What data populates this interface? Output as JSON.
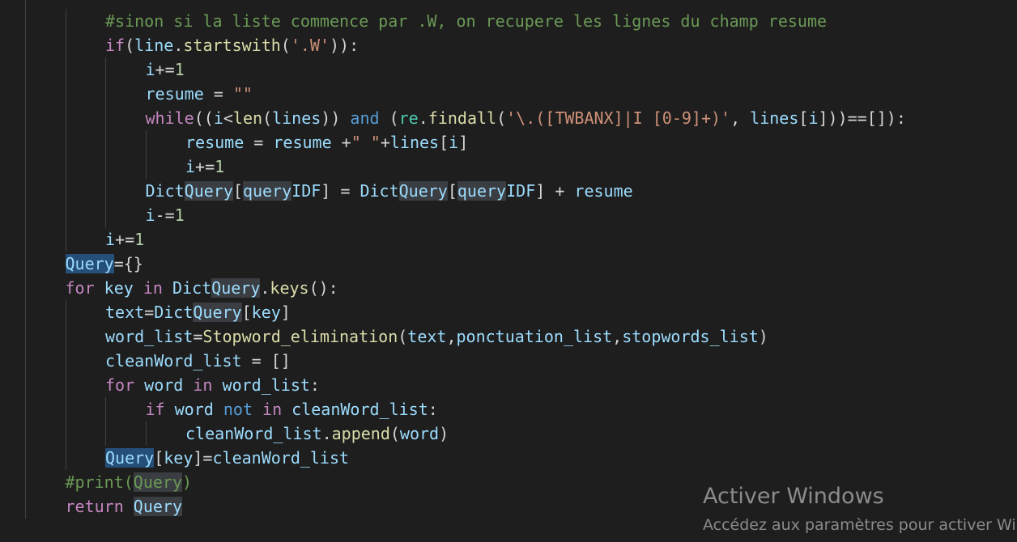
{
  "colors": {
    "background": "#1e1e1e",
    "keyword": "#c586c0",
    "storage_keyword": "#569cd6",
    "variable": "#9cdcfe",
    "function": "#dcdcaa",
    "string": "#ce9178",
    "number": "#b5cea8",
    "comment": "#6a9955",
    "module": "#4ec9b0",
    "operator": "#d4d4d4",
    "selection_highlight": "#3a3d41",
    "word_highlight": "#264f78",
    "watermark": "#8b8b8b"
  },
  "code_lines": [
    {
      "indent": 2,
      "tokens": [
        {
          "t": "#sinon si la liste commence par .W, on recupere les lignes du champ resume",
          "c": "cm"
        }
      ]
    },
    {
      "indent": 2,
      "tokens": [
        {
          "t": "if",
          "c": "kw"
        },
        {
          "t": "(",
          "c": "op"
        },
        {
          "t": "line",
          "c": "var"
        },
        {
          "t": ".",
          "c": "op"
        },
        {
          "t": "startswith",
          "c": "fn"
        },
        {
          "t": "(",
          "c": "op"
        },
        {
          "t": "'.W'",
          "c": "str"
        },
        {
          "t": ")):",
          "c": "op"
        }
      ]
    },
    {
      "indent": 3,
      "tokens": [
        {
          "t": "i",
          "c": "var"
        },
        {
          "t": "+=",
          "c": "op"
        },
        {
          "t": "1",
          "c": "num"
        }
      ]
    },
    {
      "indent": 3,
      "tokens": [
        {
          "t": "resume",
          "c": "var"
        },
        {
          "t": " = ",
          "c": "op"
        },
        {
          "t": "\"\"",
          "c": "str"
        }
      ]
    },
    {
      "indent": 3,
      "tokens": [
        {
          "t": "while",
          "c": "kw"
        },
        {
          "t": "((",
          "c": "op"
        },
        {
          "t": "i",
          "c": "var"
        },
        {
          "t": "<",
          "c": "op"
        },
        {
          "t": "len",
          "c": "fn"
        },
        {
          "t": "(",
          "c": "op"
        },
        {
          "t": "lines",
          "c": "var"
        },
        {
          "t": ")) ",
          "c": "op"
        },
        {
          "t": "and",
          "c": "st"
        },
        {
          "t": " (",
          "c": "op"
        },
        {
          "t": "re",
          "c": "mod"
        },
        {
          "t": ".",
          "c": "op"
        },
        {
          "t": "findall",
          "c": "fn"
        },
        {
          "t": "(",
          "c": "op"
        },
        {
          "t": "'\\.([TWBANX]|I [0-9]+)'",
          "c": "str"
        },
        {
          "t": ", ",
          "c": "op"
        },
        {
          "t": "lines",
          "c": "var"
        },
        {
          "t": "[",
          "c": "op"
        },
        {
          "t": "i",
          "c": "var"
        },
        {
          "t": "]))==[]):",
          "c": "op"
        }
      ]
    },
    {
      "indent": 4,
      "tokens": [
        {
          "t": "resume",
          "c": "var"
        },
        {
          "t": " = ",
          "c": "op"
        },
        {
          "t": "resume",
          "c": "var"
        },
        {
          "t": " +",
          "c": "op"
        },
        {
          "t": "\" \"",
          "c": "str"
        },
        {
          "t": "+",
          "c": "op"
        },
        {
          "t": "lines",
          "c": "var"
        },
        {
          "t": "[",
          "c": "op"
        },
        {
          "t": "i",
          "c": "var"
        },
        {
          "t": "]",
          "c": "op"
        }
      ]
    },
    {
      "indent": 4,
      "tokens": [
        {
          "t": "i",
          "c": "var"
        },
        {
          "t": "+=",
          "c": "op"
        },
        {
          "t": "1",
          "c": "num"
        }
      ]
    },
    {
      "indent": 3,
      "tokens": [
        {
          "t": "Dict",
          "c": "var"
        },
        {
          "t": "Query",
          "c": "var",
          "hl": true
        },
        {
          "t": "[",
          "c": "op"
        },
        {
          "t": "query",
          "c": "var",
          "hl": true
        },
        {
          "t": "IDF",
          "c": "var"
        },
        {
          "t": "] = ",
          "c": "op"
        },
        {
          "t": "Dict",
          "c": "var"
        },
        {
          "t": "Query",
          "c": "var",
          "hl": true
        },
        {
          "t": "[",
          "c": "op"
        },
        {
          "t": "query",
          "c": "var",
          "hl": true
        },
        {
          "t": "IDF",
          "c": "var"
        },
        {
          "t": "] + ",
          "c": "op"
        },
        {
          "t": "resume",
          "c": "var"
        }
      ]
    },
    {
      "indent": 3,
      "tokens": [
        {
          "t": "i",
          "c": "var"
        },
        {
          "t": "-=",
          "c": "op"
        },
        {
          "t": "1",
          "c": "num"
        }
      ]
    },
    {
      "indent": 2,
      "tokens": [
        {
          "t": "i",
          "c": "var"
        },
        {
          "t": "+=",
          "c": "op"
        },
        {
          "t": "1",
          "c": "num"
        }
      ]
    },
    {
      "indent": 1,
      "tokens": [
        {
          "t": "Query",
          "c": "var",
          "hl2": true
        },
        {
          "t": "={}",
          "c": "op"
        }
      ]
    },
    {
      "indent": 1,
      "tokens": [
        {
          "t": "for",
          "c": "kw"
        },
        {
          "t": " ",
          "c": "op"
        },
        {
          "t": "key",
          "c": "var"
        },
        {
          "t": " ",
          "c": "op"
        },
        {
          "t": "in",
          "c": "kw"
        },
        {
          "t": " ",
          "c": "op"
        },
        {
          "t": "Dict",
          "c": "var"
        },
        {
          "t": "Query",
          "c": "var",
          "hl": true
        },
        {
          "t": ".",
          "c": "op"
        },
        {
          "t": "keys",
          "c": "fn"
        },
        {
          "t": "():",
          "c": "op"
        }
      ]
    },
    {
      "indent": 2,
      "tokens": [
        {
          "t": "text",
          "c": "var"
        },
        {
          "t": "=",
          "c": "op"
        },
        {
          "t": "Dict",
          "c": "var"
        },
        {
          "t": "Query",
          "c": "var",
          "hl": true
        },
        {
          "t": "[",
          "c": "op"
        },
        {
          "t": "key",
          "c": "var"
        },
        {
          "t": "]",
          "c": "op"
        }
      ]
    },
    {
      "indent": 2,
      "tokens": [
        {
          "t": "word_list",
          "c": "var"
        },
        {
          "t": "=",
          "c": "op"
        },
        {
          "t": "Stopword_elimination",
          "c": "fn"
        },
        {
          "t": "(",
          "c": "op"
        },
        {
          "t": "text",
          "c": "var"
        },
        {
          "t": ",",
          "c": "op"
        },
        {
          "t": "ponctuation_list",
          "c": "var"
        },
        {
          "t": ",",
          "c": "op"
        },
        {
          "t": "stopwords_list",
          "c": "var"
        },
        {
          "t": ")",
          "c": "op"
        }
      ]
    },
    {
      "indent": 2,
      "tokens": [
        {
          "t": "cleanWord_list",
          "c": "var"
        },
        {
          "t": " = []",
          "c": "op"
        }
      ]
    },
    {
      "indent": 2,
      "tokens": [
        {
          "t": "for",
          "c": "kw"
        },
        {
          "t": " ",
          "c": "op"
        },
        {
          "t": "word",
          "c": "var"
        },
        {
          "t": " ",
          "c": "op"
        },
        {
          "t": "in",
          "c": "kw"
        },
        {
          "t": " ",
          "c": "op"
        },
        {
          "t": "word_list",
          "c": "var"
        },
        {
          "t": ":",
          "c": "op"
        }
      ]
    },
    {
      "indent": 3,
      "tokens": [
        {
          "t": "if",
          "c": "kw"
        },
        {
          "t": " ",
          "c": "op"
        },
        {
          "t": "word",
          "c": "var"
        },
        {
          "t": " ",
          "c": "op"
        },
        {
          "t": "not",
          "c": "st"
        },
        {
          "t": " ",
          "c": "op"
        },
        {
          "t": "in",
          "c": "kw"
        },
        {
          "t": " ",
          "c": "op"
        },
        {
          "t": "cleanWord_list",
          "c": "var"
        },
        {
          "t": ":",
          "c": "op"
        }
      ]
    },
    {
      "indent": 4,
      "tokens": [
        {
          "t": "cleanWord_list",
          "c": "var"
        },
        {
          "t": ".",
          "c": "op"
        },
        {
          "t": "append",
          "c": "fn"
        },
        {
          "t": "(",
          "c": "op"
        },
        {
          "t": "word",
          "c": "var"
        },
        {
          "t": ")",
          "c": "op"
        }
      ]
    },
    {
      "indent": 2,
      "tokens": [
        {
          "t": "Query",
          "c": "var",
          "hl2": true
        },
        {
          "t": "[",
          "c": "op"
        },
        {
          "t": "key",
          "c": "var"
        },
        {
          "t": "]=",
          "c": "op"
        },
        {
          "t": "cleanWord_list",
          "c": "var"
        }
      ]
    },
    {
      "indent": 1,
      "tokens": [
        {
          "t": "#print(",
          "c": "cm"
        },
        {
          "t": "Query",
          "c": "cm",
          "hl": true
        },
        {
          "t": ")",
          "c": "cm"
        }
      ]
    },
    {
      "indent": 1,
      "tokens": [
        {
          "t": "return",
          "c": "kw"
        },
        {
          "t": " ",
          "c": "op"
        },
        {
          "t": "Query",
          "c": "var",
          "hl": true
        }
      ]
    }
  ],
  "watermark": {
    "title": "Activer Windows",
    "subtitle": "Accédez aux paramètres pour activer Windows."
  }
}
